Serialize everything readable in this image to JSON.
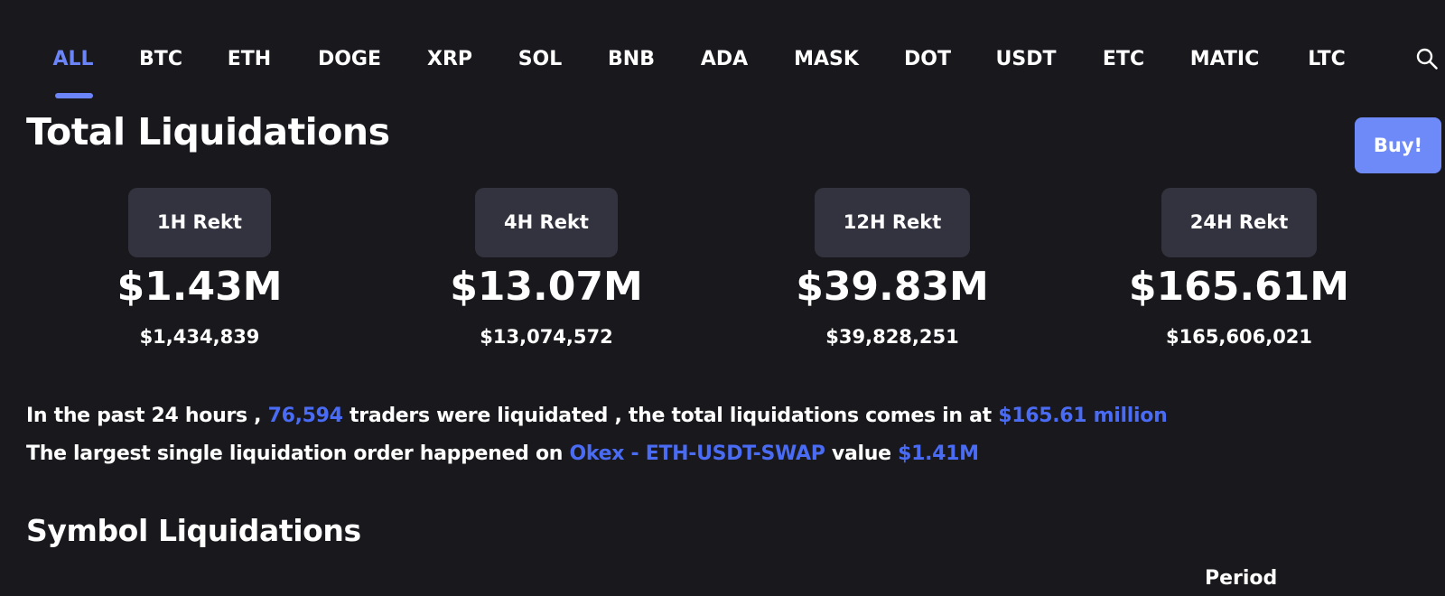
{
  "nav": {
    "tabs": [
      {
        "label": "ALL",
        "active": true
      },
      {
        "label": "BTC",
        "active": false
      },
      {
        "label": "ETH",
        "active": false
      },
      {
        "label": "DOGE",
        "active": false
      },
      {
        "label": "XRP",
        "active": false
      },
      {
        "label": "SOL",
        "active": false
      },
      {
        "label": "BNB",
        "active": false
      },
      {
        "label": "ADA",
        "active": false
      },
      {
        "label": "MASK",
        "active": false
      },
      {
        "label": "DOT",
        "active": false
      },
      {
        "label": "USDT",
        "active": false
      },
      {
        "label": "ETC",
        "active": false
      },
      {
        "label": "MATIC",
        "active": false
      },
      {
        "label": "LTC",
        "active": false
      }
    ],
    "search_icon": "search-icon"
  },
  "header": {
    "title": "Total Liquidations",
    "buy_label": "Buy!"
  },
  "stats": [
    {
      "period": "1H Rekt",
      "short": "$1.43M",
      "full": "$1,434,839"
    },
    {
      "period": "4H Rekt",
      "short": "$13.07M",
      "full": "$13,074,572"
    },
    {
      "period": "12H Rekt",
      "short": "$39.83M",
      "full": "$39,828,251"
    },
    {
      "period": "24H Rekt",
      "short": "$165.61M",
      "full": "$165,606,021"
    }
  ],
  "summary": {
    "line1_prefix": "In the past 24 hours ,",
    "traders_count": "76,594",
    "line1_middle": "traders were liquidated , the total liquidations comes in at",
    "total_amount": "$165.61 million",
    "line2_prefix": "The largest single liquidation order happened on",
    "largest_order_link": "Okex - ETH-USDT-SWAP",
    "line2_middle": "value",
    "largest_value": "$1.41M"
  },
  "symbols": {
    "title": "Symbol Liquidations",
    "period_label": "Period"
  },
  "colors": {
    "background": "#19181c",
    "accent": "#6b84f7",
    "link": "#4a6bf3",
    "badge": "#32333f",
    "buy_button": "#6d8af8"
  }
}
